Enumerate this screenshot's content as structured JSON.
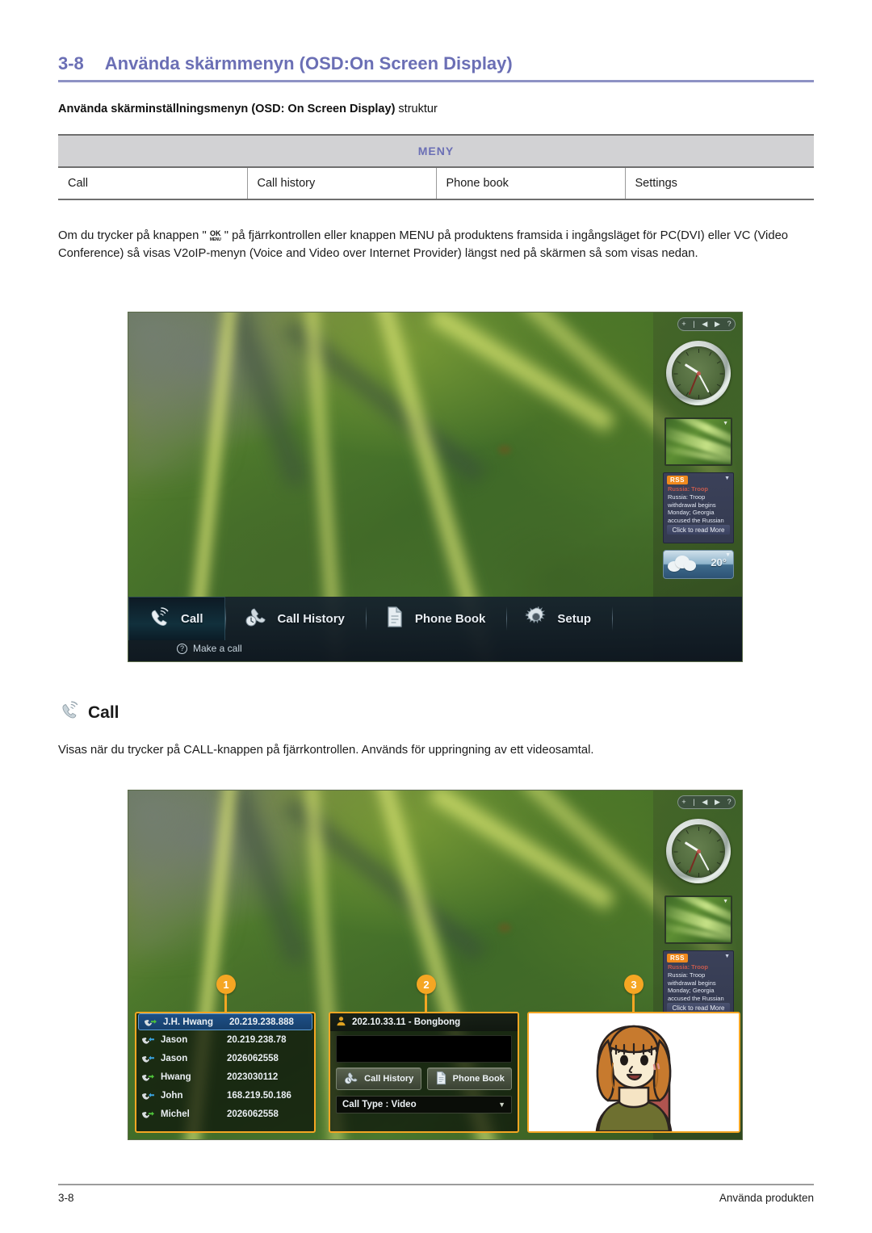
{
  "header": {
    "section_number": "3-8",
    "title": "Använda skärmmenyn (OSD:On Screen Display)"
  },
  "subheading": {
    "bold": "Använda skärminställningsmenyn (OSD: On Screen Display)",
    "light": " struktur"
  },
  "meny_table": {
    "header": "MENY",
    "columns": [
      "Call",
      "Call history",
      "Phone book",
      "Settings"
    ]
  },
  "paragraphs": {
    "intro_part1": "Om du trycker på knappen \"",
    "intro_button_top": "OK",
    "intro_button_bottom": "MENU",
    "intro_part2": "\" på fjärrkontrollen eller knappen MENU på produktens framsida i ingångsläget för PC(DVI) eller VC (Video Conference) så visas V2oIP-menyn (Voice and Video over Internet Provider) längst ned på skärmen så som visas nedan.",
    "call_desc": "Visas när du trycker på CALL-knappen på fjärrkontrollen. Används för uppringning av ett videosamtal."
  },
  "call_section": {
    "heading": "Call"
  },
  "osd": {
    "tabs": [
      {
        "label": "Call",
        "icon": "phone-handset-icon",
        "active": true
      },
      {
        "label": "Call History",
        "icon": "call-history-icon",
        "active": false
      },
      {
        "label": "Phone Book",
        "icon": "phone-book-icon",
        "active": false
      },
      {
        "label": "Setup",
        "icon": "gear-icon",
        "active": false
      }
    ],
    "hint": "Make a call"
  },
  "sidebar": {
    "gadget_controls": [
      "+",
      "|",
      "◀",
      "▶",
      "?"
    ],
    "rss": {
      "badge": "RSS",
      "headline": "Russia: Troop",
      "body": "Russia: Troop withdrawal begins Monday; Georgia accused the Russian army of",
      "more_link": "Click to read More"
    },
    "weather": {
      "temperature": "20°"
    }
  },
  "call_screen": {
    "callouts": [
      "1",
      "2",
      "3"
    ],
    "history_list": [
      {
        "name": "J.H. Hwang",
        "number": "20.219.238.888",
        "direction": "outgoing",
        "selected": true
      },
      {
        "name": "Jason",
        "number": "20.219.238.78",
        "direction": "incoming",
        "selected": false
      },
      {
        "name": "Jason",
        "number": "2026062558",
        "direction": "incoming",
        "selected": false
      },
      {
        "name": "Hwang",
        "number": "2023030112",
        "direction": "outgoing",
        "selected": false
      },
      {
        "name": "John",
        "number": "168.219.50.186",
        "direction": "incoming",
        "selected": false
      },
      {
        "name": "Michel",
        "number": "2026062558",
        "direction": "outgoing",
        "selected": false
      }
    ],
    "dial_panel": {
      "title": "202.10.33.11 - Bongbong",
      "input_value": "",
      "button_call_history": "Call History",
      "button_phone_book": "Phone Book",
      "call_type_label": "Call Type : Video"
    }
  },
  "footer": {
    "page_number": "3-8",
    "chapter": "Använda produkten"
  },
  "colors": {
    "title": "#6b6fb5",
    "table_header_bg": "#d2d2d4",
    "callout": "#f5a623",
    "rss_badge": "#f08a1d"
  }
}
